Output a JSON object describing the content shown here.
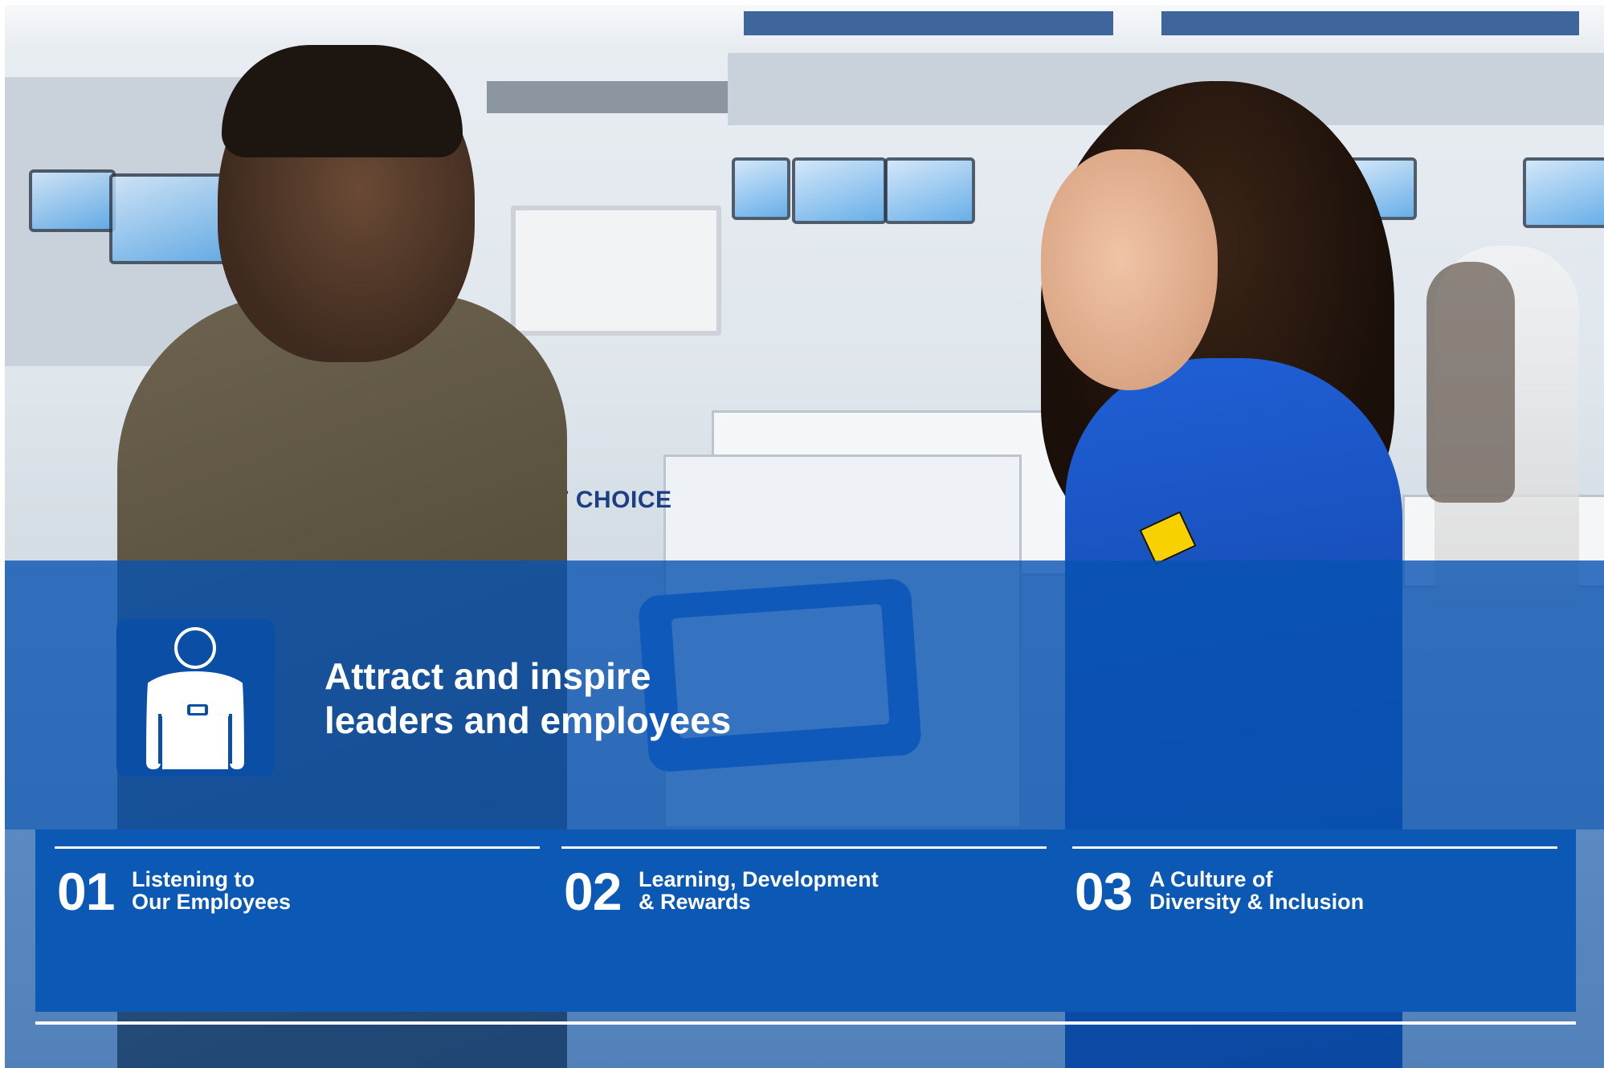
{
  "heading": {
    "line1": "Attract and inspire",
    "line2": "leaders and employees"
  },
  "icon": {
    "name": "employee-icon"
  },
  "photo_sign": {
    "text": "BEST CHOICE"
  },
  "sections": [
    {
      "number": "01",
      "line1": "Listening to",
      "line2": "Our Employees"
    },
    {
      "number": "02",
      "line1": "Learning, Development",
      "line2": "& Rewards"
    },
    {
      "number": "03",
      "line1": "A Culture of",
      "line2": "Diversity & Inclusion"
    }
  ],
  "colors": {
    "overlay_blue": "#0753b2",
    "panel_blue": "#0b58b5",
    "tile_blue": "#0a4ea6",
    "text": "#ffffff"
  }
}
